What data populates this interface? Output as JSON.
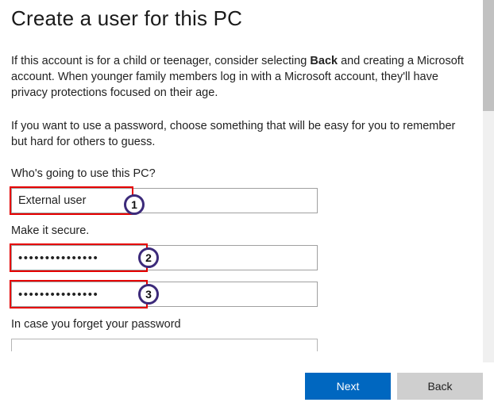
{
  "title": "Create a user for this PC",
  "paragraph1_a": "If this account is for a child or teenager, consider selecting ",
  "paragraph1_bold": "Back",
  "paragraph1_b": " and creating a Microsoft account. When younger family members log in with a Microsoft account, they'll have privacy protections focused on their age.",
  "paragraph2": "If you want to use a password, choose something that will be easy for you to remember but hard for others to guess.",
  "section_user_label": "Who's going to use this PC?",
  "username_value": "External user",
  "section_secure_label": "Make it secure.",
  "password_value": "•••••••••••••••",
  "confirm_value": "•••••••••••••••",
  "section_forgot_label": "In case you forget your password",
  "markers": {
    "m1": "1",
    "m2": "2",
    "m3": "3"
  },
  "buttons": {
    "next": "Next",
    "back": "Back"
  }
}
